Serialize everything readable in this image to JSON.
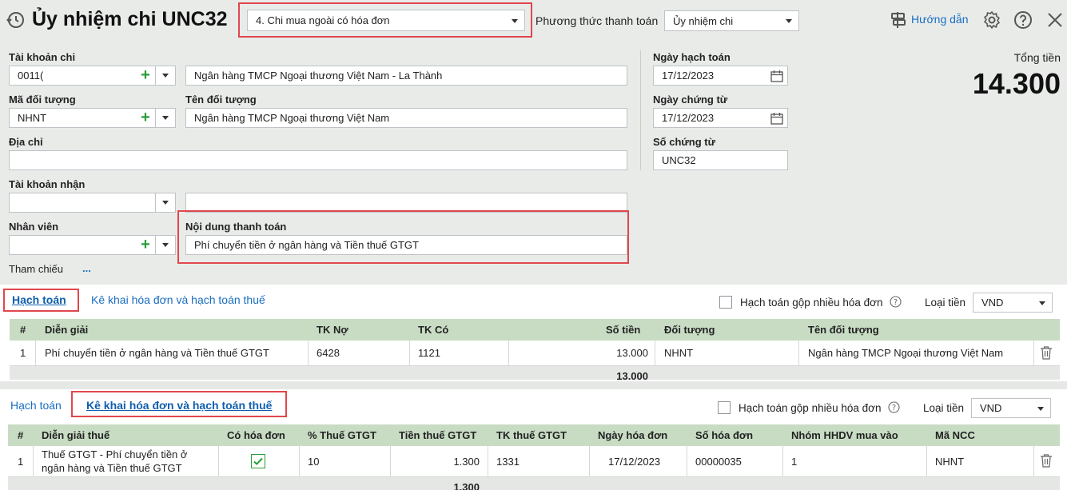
{
  "header": {
    "title": "Ủy nhiệm chi UNC32",
    "voucher_type": "4. Chi mua ngoài có hóa đơn",
    "payment_method_label": "Phương thức thanh toán",
    "payment_method_value": "Ủy nhiệm chi",
    "guide_label": "Hướng dẫn"
  },
  "form": {
    "account_label": "Tài khoản chi",
    "account_value": "0011(",
    "bank_name": "Ngân hàng TMCP Ngoại thương Việt Nam - La Thành",
    "object_code_label": "Mã đối tượng",
    "object_code_value": "NHNT",
    "object_name_label": "Tên đối tượng",
    "object_name_value": "Ngân hàng TMCP Ngoại thương Việt Nam",
    "address_label": "Địa chỉ",
    "address_value": "",
    "receive_account_label": "Tài khoản nhận",
    "receive_account_value": "",
    "receive_account_bank": "",
    "employee_label": "Nhân viên",
    "employee_value": "",
    "content_label": "Nội dung thanh toán",
    "content_value": "Phí chuyển tiền ở ngân hàng và Tiền thuế GTGT",
    "reference_label": "Tham chiếu",
    "reference_more": "..."
  },
  "dates": {
    "posting_date_label": "Ngày hạch toán",
    "posting_date_value": "17/12/2023",
    "voucher_date_label": "Ngày chứng từ",
    "voucher_date_value": "17/12/2023",
    "voucher_no_label": "Số chứng từ",
    "voucher_no_value": "UNC32"
  },
  "total": {
    "label": "Tổng tiền",
    "value": "14.300"
  },
  "section1": {
    "tab_accounting": "Hạch toán",
    "tab_invoice": "Kê khai hóa đơn và hạch toán thuế",
    "merge_label": "Hạch toán gộp nhiều hóa đơn",
    "currency_label": "Loại tiền",
    "currency_value": "VND",
    "columns": [
      "#",
      "Diễn giải",
      "TK Nợ",
      "TK Có",
      "Số tiền",
      "Đối tượng",
      "Tên đối tượng"
    ],
    "rows": [
      {
        "no": "1",
        "desc": "Phí chuyển tiền ở ngân hàng và Tiền thuế GTGT",
        "debit": "6428",
        "credit": "1121",
        "amount": "13.000",
        "object": "NHNT",
        "object_name": "Ngân hàng TMCP Ngoại thương Việt Nam"
      }
    ],
    "sum_amount": "13.000"
  },
  "section2": {
    "tab_accounting": "Hạch toán",
    "tab_invoice": "Kê khai hóa đơn và hạch toán thuế",
    "merge_label": "Hạch toán gộp nhiều hóa đơn",
    "currency_label": "Loại tiền",
    "currency_value": "VND",
    "columns": [
      "#",
      "Diễn giải thuế",
      "Có hóa đơn",
      "% Thuế GTGT",
      "Tiền thuế GTGT",
      "TK thuế GTGT",
      "Ngày hóa đơn",
      "Số hóa đơn",
      "Nhóm HHDV mua vào",
      "Mã NCC"
    ],
    "rows": [
      {
        "no": "1",
        "desc_line1": "Thuế GTGT - Phí chuyển tiền ở",
        "desc_line2": "ngân hàng và Tiền thuế GTGT",
        "has_invoice": true,
        "vat_rate": "10",
        "vat_amount": "1.300",
        "vat_account": "1331",
        "invoice_date": "17/12/2023",
        "invoice_no": "00000035",
        "group": "1",
        "supplier": "NHNT"
      }
    ],
    "sum_vat": "1.300"
  },
  "colors": {
    "accent_red": "#e0474c",
    "link_blue": "#1a6ec3",
    "grid_header": "#c8dcc4",
    "plus_green": "#2a9d3a"
  }
}
